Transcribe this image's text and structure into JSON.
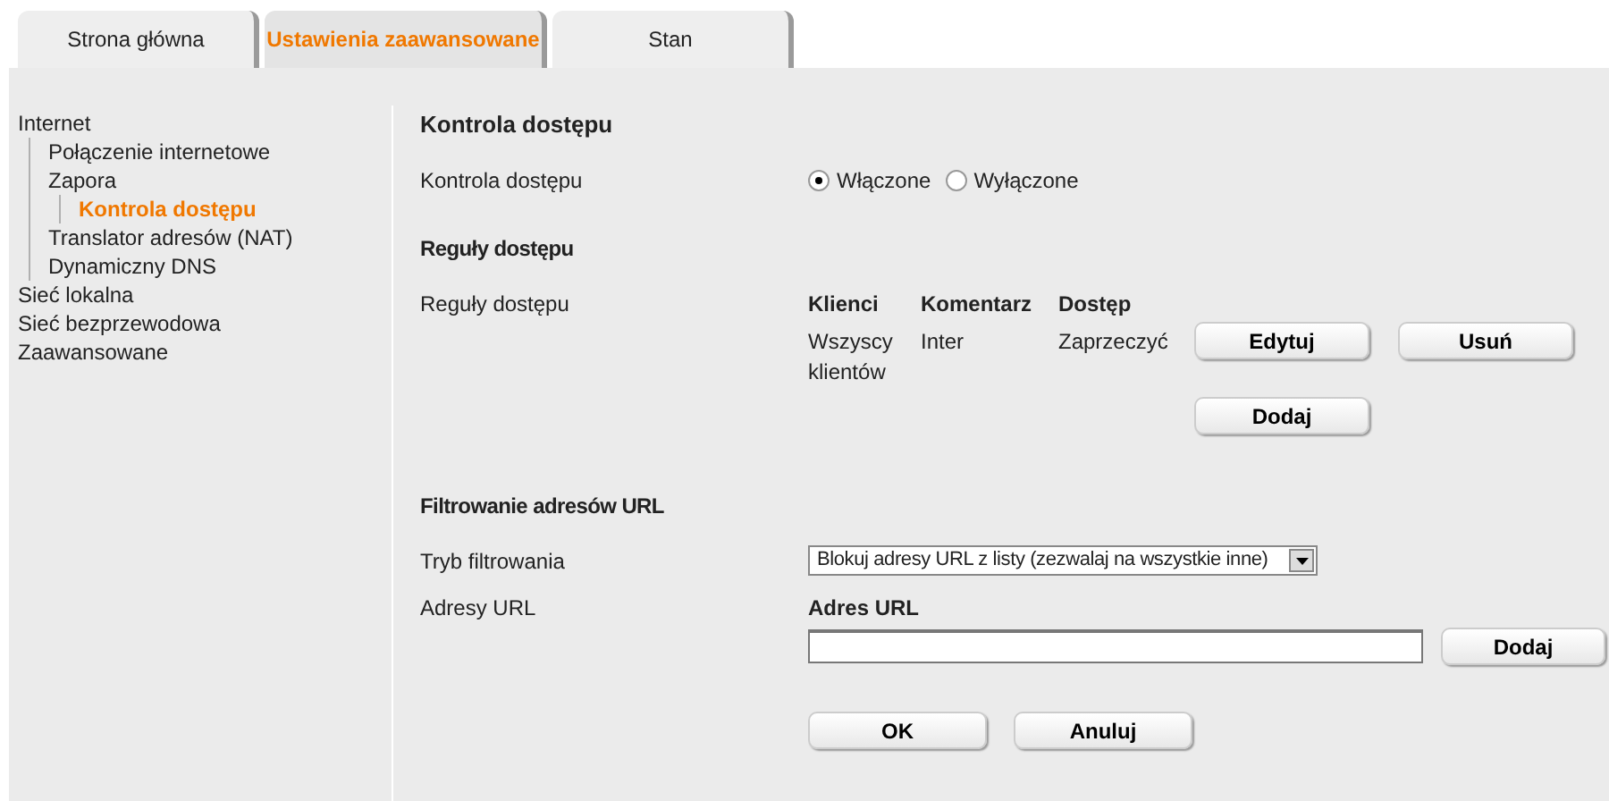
{
  "tabs": [
    {
      "label": "Strona główna",
      "selected": false
    },
    {
      "label": "Ustawienia zaawansowane",
      "selected": true
    },
    {
      "label": "Stan",
      "selected": false
    }
  ],
  "sidebar": {
    "items": [
      {
        "label": "Internet",
        "selected": false,
        "children": [
          {
            "label": "Połączenie internetowe",
            "selected": false
          },
          {
            "label": "Zapora",
            "selected": false,
            "children": [
              {
                "label": "Kontrola dostępu",
                "selected": true
              }
            ]
          },
          {
            "label": "Translator adresów (NAT)",
            "selected": false
          },
          {
            "label": "Dynamiczny DNS",
            "selected": false
          }
        ]
      },
      {
        "label": "Sieć lokalna",
        "selected": false
      },
      {
        "label": "Sieć bezprzewodowa",
        "selected": false
      },
      {
        "label": "Zaawansowane",
        "selected": false
      }
    ]
  },
  "title": "Kontrola dostępu",
  "access_control": {
    "label": "Kontrola dostępu",
    "options": [
      {
        "label": "Włączone",
        "selected": true
      },
      {
        "label": "Wyłączone",
        "selected": false
      }
    ]
  },
  "rules": {
    "heading": "Reguły dostępu",
    "label": "Reguły dostępu",
    "columns": [
      "Klienci",
      "Komentarz",
      "Dostęp"
    ],
    "rows": [
      [
        "Wszyscy klientów",
        "Inter",
        "Zaprzeczyć"
      ]
    ],
    "row_buttons": [
      "Edytuj",
      "Usuń"
    ],
    "add_button": "Dodaj"
  },
  "url_filter": {
    "heading": "Filtrowanie adresów URL",
    "mode_label": "Tryb filtrowania",
    "mode_value": "Blokuj adresy URL z listy (zezwalaj na wszystkie inne)",
    "urls_label": "Adresy URL",
    "column": "Adres URL",
    "add_button": "Dodaj"
  },
  "buttons": [
    "OK",
    "Anuluj"
  ]
}
